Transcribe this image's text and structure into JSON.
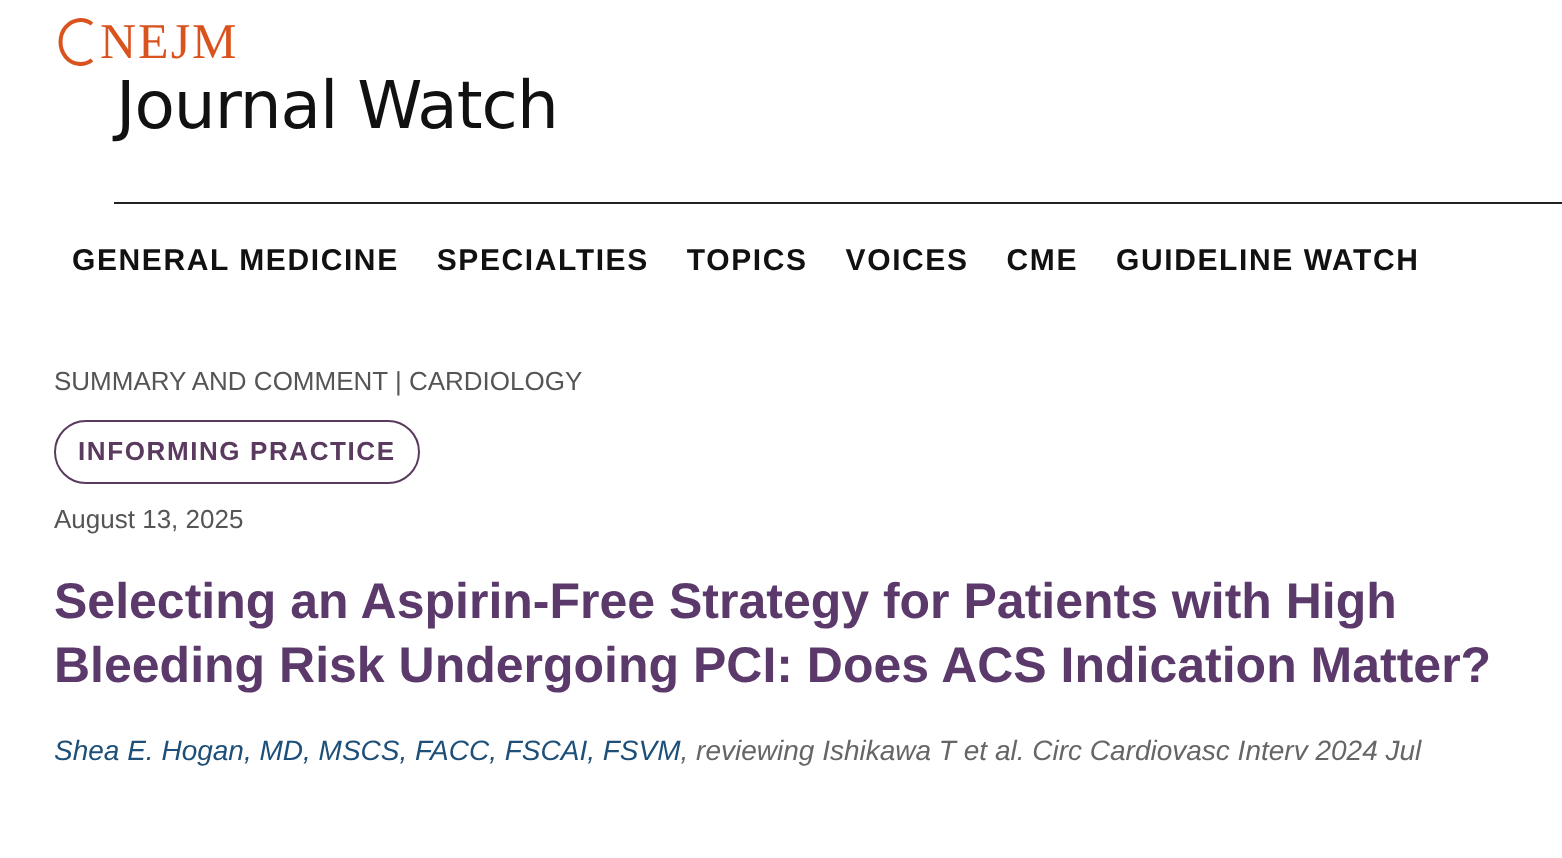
{
  "logo": {
    "brand": "NEJM",
    "name": "Journal Watch"
  },
  "nav": [
    {
      "label": "GENERAL MEDICINE"
    },
    {
      "label": "SPECIALTIES"
    },
    {
      "label": "TOPICS"
    },
    {
      "label": "VOICES"
    },
    {
      "label": "CME"
    },
    {
      "label": "GUIDELINE WATCH"
    }
  ],
  "article": {
    "category": "SUMMARY AND COMMENT | CARDIOLOGY",
    "tag": "INFORMING PRACTICE",
    "date": "August 13, 2025",
    "title": "Selecting an Aspirin-Free Strategy for Patients with High Bleeding Risk Undergoing PCI: Does ACS Indication Matter?",
    "author": "Shea E. Hogan, MD, MSCS, FACC, FSCAI, FSVM",
    "reviewing": ", reviewing Ishikawa T et al. Circ Cardiovasc Interv 2024 Jul"
  }
}
